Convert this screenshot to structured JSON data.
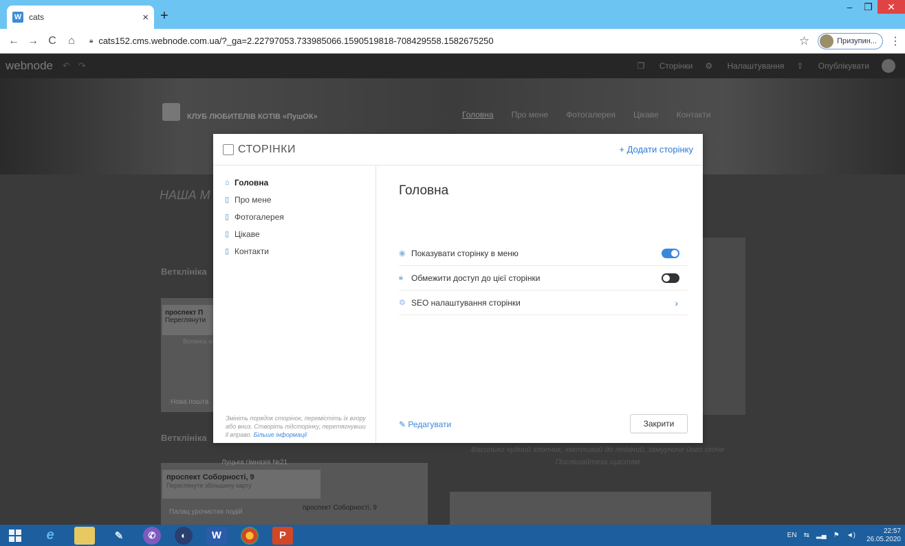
{
  "browser": {
    "tab_title": "cats",
    "tab_favicon": "W",
    "url": "cats152.cms.webnode.com.ua/?_ga=2.22797053.733985066.1590519818-708429558.1582675250",
    "profile_name": "Призупин..."
  },
  "editor": {
    "logo": "webnode",
    "pages_label": "Сторінки",
    "settings_label": "Налаштування",
    "publish_label": "Опублікувати"
  },
  "site": {
    "name": "КЛУБ ЛЮБИТЕЛІВ КОТІВ «ПушОК»",
    "nav": [
      "Головна",
      "Про мене",
      "Фотогалерея",
      "Цікаве",
      "Контакти"
    ],
    "hero": "НАША М",
    "vet1": "Ветклініка",
    "map1_card_title": "проспект П",
    "map1_card_sub": "Переглянути",
    "map1_text": "Волинсь клініч",
    "map1_np": "Нова пошта",
    "vet2": "Ветклініка",
    "map2_top": "Луцька гімназія №21",
    "map2_card_title": "проспект Соборності, 9",
    "map2_card_sub": "Переглянути збільшену карту",
    "map2_label1": "Палац урочистих подій",
    "map2_label2": "проспект Соборності, 9",
    "caption_line1": "Васипько чудний хлопчик, кмітливий до ледачий, замурчоче його скоче",
    "caption_line2": "Послішайтеза щастям"
  },
  "modal": {
    "title": "СТОРІНКИ",
    "add_page": "+ Додати сторінку",
    "pages": [
      "Головна",
      "Про мене",
      "Фотогалерея",
      "Цікаве",
      "Контакти"
    ],
    "hint_text": "Змініть порядок сторінок, перемістіть їх вгору або вниз. Створіть підсторінку, перетягнувши її вправо.",
    "hint_link": "Більше інформації",
    "content_title": "Головна",
    "settings": {
      "show_in_menu": {
        "label": "Показувати сторінку в меню",
        "enabled": true
      },
      "restrict_access": {
        "label": "Обмежити доступ до цієї сторінки",
        "enabled": false
      },
      "seo": {
        "label": "SEO налаштування сторінки"
      }
    },
    "edit_label": "Редагувати",
    "close_label": "Закрити"
  },
  "taskbar": {
    "lang": "EN",
    "time": "22:57",
    "date": "26.05.2020"
  },
  "colors": {
    "accent": "#3a88d8",
    "tabstrip": "#6cc4f2",
    "taskbar": "#1d5f9e"
  }
}
